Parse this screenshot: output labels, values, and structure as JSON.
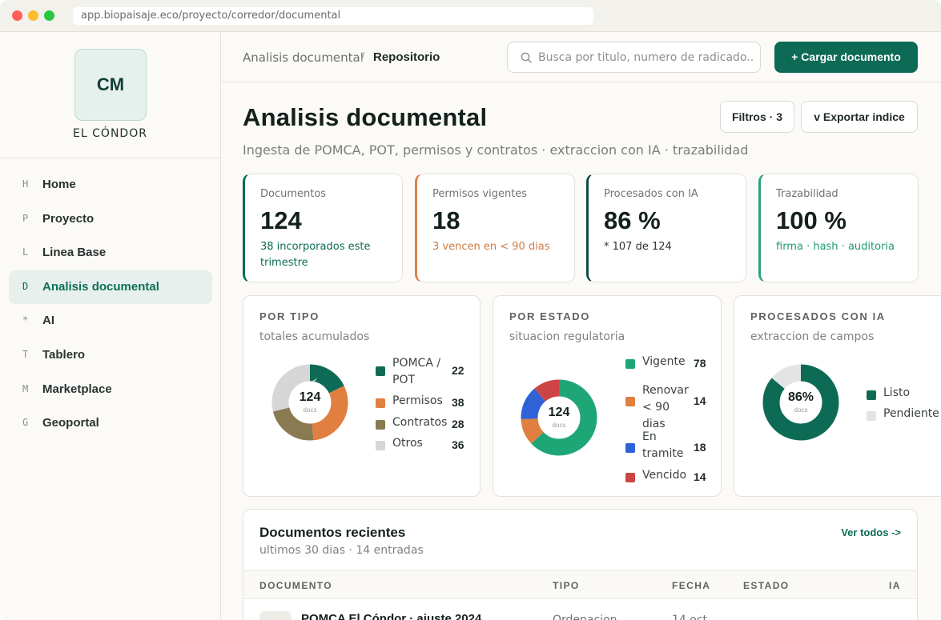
{
  "browser": {
    "url": "app.biopaisaje.eco/proyecto/corredor/documental"
  },
  "brand": {
    "initials": "CM",
    "name": "EL CÓNDOR"
  },
  "nav": [
    {
      "key": "H",
      "label": "Home",
      "active": false
    },
    {
      "key": "P",
      "label": "Proyecto",
      "active": false
    },
    {
      "key": "L",
      "label": "Linea Base",
      "active": false
    },
    {
      "key": "D",
      "label": "Analisis documental",
      "active": true
    },
    {
      "key": "*",
      "label": "AI",
      "active": false
    },
    {
      "key": "T",
      "label": "Tablero",
      "active": false
    },
    {
      "key": "M",
      "label": "Marketplace",
      "active": false
    },
    {
      "key": "G",
      "label": "Geoportal",
      "active": false
    }
  ],
  "header": {
    "breadcrumb_parent": "Analisis documental",
    "breadcrumb_sep": "/",
    "breadcrumb_current": "Repositorio",
    "search_placeholder": "Busca por titulo, numero de radicado...",
    "upload_label": "+ Cargar documento"
  },
  "page": {
    "title": "Analisis documental",
    "subtitle": "Ingesta de POMCA, POT, permisos y contratos · extraccion con IA · trazabilidad",
    "filters_label": "Filtros · 3",
    "export_label": "v  Exportar indice"
  },
  "kpis": [
    {
      "label": "Documentos",
      "value": "124",
      "note": "38 incorporados este trimestre",
      "accent": "#0d6b55",
      "note_color": "#0d6b55"
    },
    {
      "label": "Permisos vigentes",
      "value": "18",
      "note": "3 vencen en < 90 dias",
      "accent": "#d9804a",
      "note_color": "#cf7a43"
    },
    {
      "label": "Procesados con IA",
      "value": "86 %",
      "note": "* 107 de 124",
      "accent": "#0f4d3f",
      "note_color": "#2a3330"
    },
    {
      "label": "Trazabilidad",
      "value": "100 %",
      "note": "firma · hash · auditoria",
      "accent": "#2aa37c",
      "note_color": "#1f9a73"
    }
  ],
  "donuts": {
    "tipo": {
      "title": "POR TIPO",
      "subtitle": "totales acumulados",
      "center": "124",
      "unit": "docs",
      "items": [
        {
          "label": "POMCA / POT",
          "value": 22,
          "color": "#0d6b55"
        },
        {
          "label": "Permisos",
          "value": 38,
          "color": "#e07f3f"
        },
        {
          "label": "Contratos",
          "value": 28,
          "color": "#8a7a52"
        },
        {
          "label": "Otros",
          "value": 36,
          "color": "#d6d6d6"
        }
      ]
    },
    "estado": {
      "title": "POR ESTADO",
      "subtitle": "situacion regulatoria",
      "center": "124",
      "unit": "docs",
      "items": [
        {
          "label": "Vigente",
          "value": 78,
          "color": "#1ea676"
        },
        {
          "label": "Renovar < 90 dias",
          "value": 14,
          "color": "#e07f3f"
        },
        {
          "label": "En tramite",
          "value": 18,
          "color": "#2f62d6"
        },
        {
          "label": "Vencido",
          "value": 14,
          "color": "#cc4444"
        }
      ]
    },
    "ia": {
      "title": "PROCESADOS CON IA",
      "subtitle": "extraccion de campos",
      "center": "86%",
      "unit": "docs",
      "items": [
        {
          "label": "Listo",
          "value": 86,
          "color": "#0d6b55"
        },
        {
          "label": "Pendiente",
          "value": 14,
          "color": "#e4e4e4"
        }
      ]
    }
  },
  "recent": {
    "title": "Documentos recientes",
    "subtitle": "ultimos 30 dias · 14 entradas",
    "see_all": "Ver todos ->",
    "columns": [
      "DOCUMENTO",
      "TIPO",
      "FECHA",
      "ESTADO",
      "IA"
    ],
    "rows": [
      {
        "title": "POMCA El Cóndor · ajuste 2024",
        "tipo": "Ordenacion",
        "fecha": "14 oct"
      }
    ]
  }
}
